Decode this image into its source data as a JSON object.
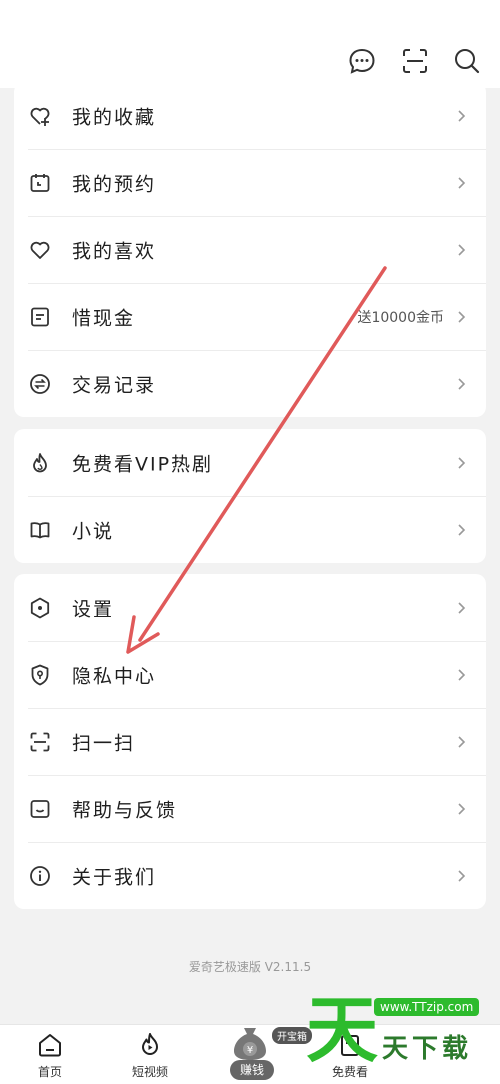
{
  "topbar": {
    "icons": [
      "message-icon",
      "scan-icon",
      "search-icon"
    ]
  },
  "group1": [
    {
      "label": "我的收藏",
      "icon": "heart-plus-icon"
    },
    {
      "label": "我的预约",
      "icon": "calendar-icon"
    },
    {
      "label": "我的喜欢",
      "icon": "heart-icon"
    },
    {
      "label": "惜现金",
      "icon": "document-icon",
      "extra": "送10000金币"
    },
    {
      "label": "交易记录",
      "icon": "exchange-icon"
    }
  ],
  "group2": [
    {
      "label": "免费看VIP热剧",
      "icon": "flame-icon"
    },
    {
      "label": "小说",
      "icon": "book-icon"
    }
  ],
  "group3": [
    {
      "label": "设置",
      "icon": "settings-icon"
    },
    {
      "label": "隐私中心",
      "icon": "shield-icon"
    },
    {
      "label": "扫一扫",
      "icon": "scan-icon"
    },
    {
      "label": "帮助与反馈",
      "icon": "feedback-icon"
    },
    {
      "label": "关于我们",
      "icon": "info-icon"
    }
  ],
  "version": "爱奇艺极速版 V2.11.5",
  "bottom_nav": {
    "home": "首页",
    "short_video": "短视频",
    "earn": "赚钱",
    "earn_badge": "开宝箱",
    "free_watch": "免费看"
  },
  "watermark": {
    "big": "天",
    "url": "www.TTzip.com",
    "text": "天下载"
  },
  "colors": {
    "arrow": "#e05a5a",
    "watermark_green": "#2dbb2d"
  }
}
